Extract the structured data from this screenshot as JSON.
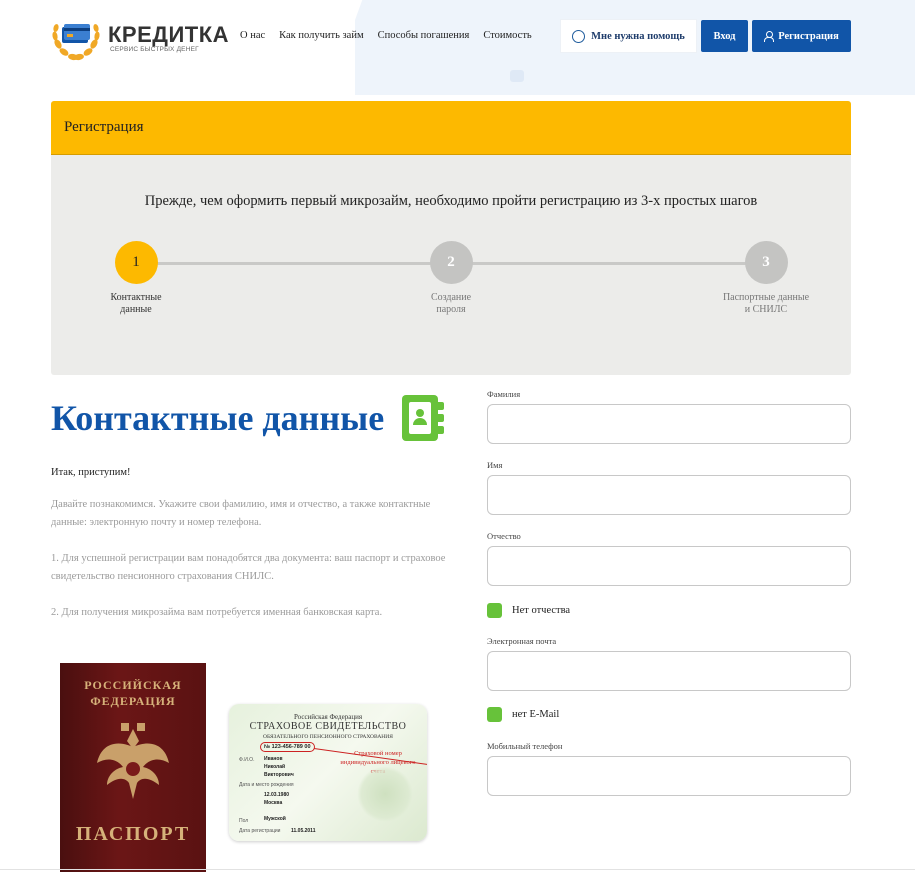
{
  "brand": {
    "name": "КРЕДИТКА",
    "tagline": "СЕРВИС БЫСТРЫХ ДЕНЕГ"
  },
  "nav": {
    "items": [
      {
        "label": "О нас"
      },
      {
        "label": "Как получить займ"
      },
      {
        "label": "Способы погашения"
      },
      {
        "label": "Стоимость"
      }
    ]
  },
  "header_buttons": {
    "help": "Мне нужна помощь",
    "login": "Вход",
    "register": "Регистрация"
  },
  "registration": {
    "title": "Регистрация",
    "intro": "Прежде, чем оформить первый микрозайм, необходимо пройти регистрацию из 3-х простых шагов",
    "steps": [
      {
        "number": "1",
        "line1": "Контактные",
        "line2": "данные",
        "active": true
      },
      {
        "number": "2",
        "line1": "Создание",
        "line2": "пароля",
        "active": false
      },
      {
        "number": "3",
        "line1": "Паспортные данные",
        "line2": "и СНИЛС",
        "active": false
      }
    ]
  },
  "contact": {
    "title": "Контактные данные",
    "lets_go": "Итак, приступим!",
    "paragraphs": [
      "Давайте познакомимся. Укажите свои фамилию, имя и отчество, а также контактные данные: электронную почту и номер телефона.",
      "1. Для успешной регистрации вам понадобятся два документа: ваш паспорт и страховое свидетельство пенсионного страхования СНИЛС.",
      "2. Для получения микрозайма вам потребуется именная банковская карта."
    ]
  },
  "passport": {
    "top_line1": "РОССИЙСКАЯ",
    "top_line2": "ФЕДЕРАЦИЯ",
    "bottom": "ПАСПОРТ"
  },
  "snils": {
    "country": "Российская Федерация",
    "title": "СТРАХОВОЕ СВИДЕТЕЛЬСТВО",
    "subtitle": "ОБЯЗАТЕЛЬНОГО ПЕНСИОННОГО СТРАХОВАНИЯ",
    "number": "№ 123-456-789 00",
    "annotation": "Страховой номер индивидуального лицевого счета",
    "fio_label": "Ф.И.О.",
    "surname": "Иванов",
    "name": "Николай",
    "patronymic": "Викторович",
    "birth_label": "Дата и место рождения",
    "birth_date": "12.03.1980",
    "birth_place": "Москва",
    "sex_label": "Пол",
    "sex": "Мужской",
    "reg_label": "Дата регистрации",
    "reg_date": "11.05.2011"
  },
  "form": {
    "surname_label": "Фамилия",
    "name_label": "Имя",
    "patronymic_label": "Отчество",
    "no_patronymic": "Нет отчества",
    "email_label": "Электронная почта",
    "no_email": "нет E-Mail",
    "phone_label": "Мобильный телефон",
    "surname_value": "",
    "name_value": "",
    "patronymic_value": "",
    "email_value": "",
    "phone_value": ""
  },
  "colors": {
    "brand_blue": "#1155a8",
    "accent_yellow": "#fdb900",
    "check_green": "#67c23a"
  }
}
